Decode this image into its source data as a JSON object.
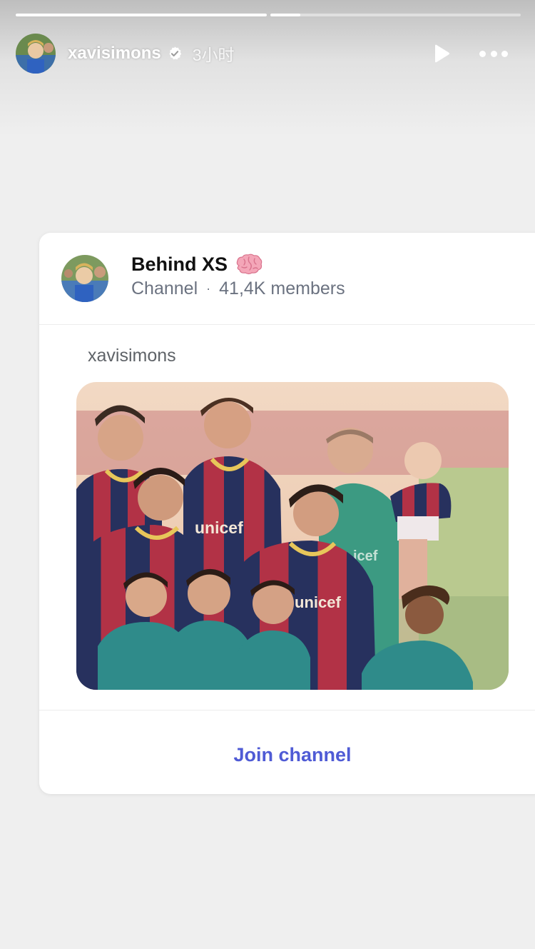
{
  "story": {
    "progress": [
      {
        "fill": 1.0
      },
      {
        "fill": 0.12
      }
    ],
    "username": "xavisimons",
    "time": "3小时",
    "icons": {
      "verified": "verified-badge-icon",
      "play": "play-icon",
      "more": "more-options-icon"
    }
  },
  "card": {
    "channel_name": "Behind XS",
    "channel_emoji": "brain-emoji",
    "channel_type": "Channel",
    "separator": "·",
    "members": "41,4K members",
    "post_author": "xavisimons",
    "image_text": {
      "shirt_sponsor_1": "unicef",
      "shirt_sponsor_2": "unicef"
    },
    "join_label": "Join channel"
  },
  "colors": {
    "background": "#efefef",
    "card": "#ffffff",
    "join_link": "#4f5bd5",
    "meta_text": "#6b7280"
  }
}
